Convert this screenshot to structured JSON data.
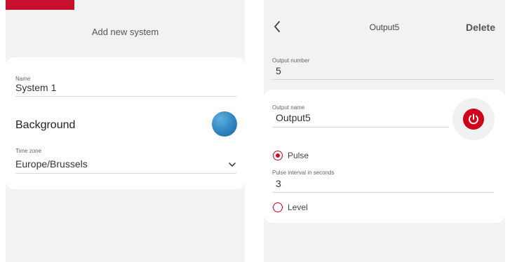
{
  "left": {
    "title": "Add new system",
    "name_field": {
      "label": "Name",
      "value": "System 1"
    },
    "background": {
      "label": "Background",
      "color": "#2f84bf"
    },
    "timezone_field": {
      "label": "Time zone",
      "value": "Europe/Brussels"
    },
    "icons": {
      "dropdown": "chevron-down-icon"
    },
    "brand_color": "#c8102e"
  },
  "right": {
    "header": {
      "back_icon": "chevron-left-icon",
      "title": "Output5",
      "delete_label": "Delete"
    },
    "output_number": {
      "label": "Output number",
      "value": "5"
    },
    "output_name": {
      "label": "Output name",
      "value": "Output5"
    },
    "power_icon": "power-icon",
    "mode_options": [
      {
        "label": "Pulse",
        "selected": true
      },
      {
        "label": "Level",
        "selected": false
      }
    ],
    "pulse_interval": {
      "label": "Pulse interval in seconds",
      "value": "3"
    },
    "accent_color": "#d0021b"
  }
}
